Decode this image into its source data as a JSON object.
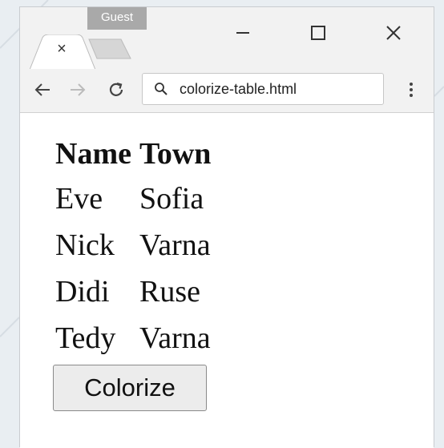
{
  "browser": {
    "profile_badge": "Guest",
    "tab_close_glyph": "×",
    "url": "colorize-table.html"
  },
  "table": {
    "headers": [
      "Name",
      "Town"
    ],
    "rows": [
      [
        "Eve",
        "Sofia"
      ],
      [
        "Nick",
        "Varna"
      ],
      [
        "Didi",
        "Ruse"
      ],
      [
        "Tedy",
        "Varna"
      ]
    ]
  },
  "button": {
    "label": "Colorize"
  },
  "icons": [
    "back-arrow-icon",
    "forward-arrow-icon",
    "reload-icon",
    "search-icon",
    "menu-icon",
    "minimize-icon",
    "maximize-icon",
    "close-icon"
  ]
}
